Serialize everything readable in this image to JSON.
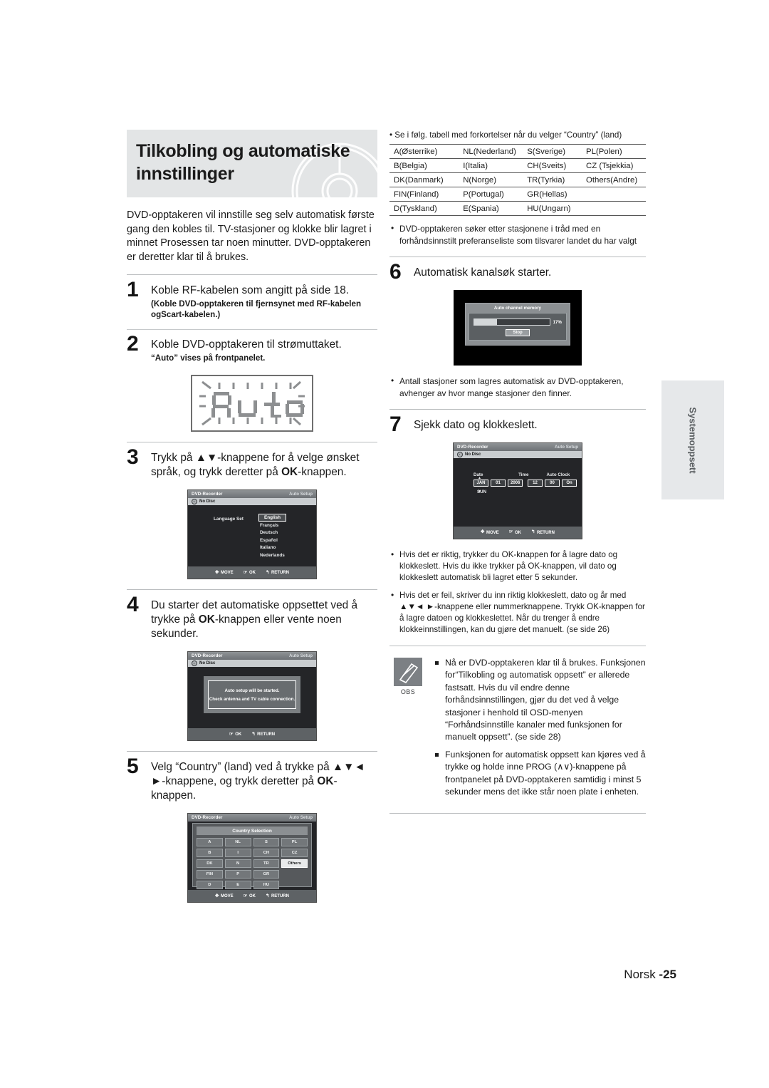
{
  "header": {
    "title": "Tilkobling og automatiske innstillinger",
    "disc_icon": "dvd-disc-illustration"
  },
  "intro": "DVD-opptakeren vil innstille seg selv automatisk første gang den kobles til. TV-stasjoner og klokke blir lagret i minnet Prosessen tar noen minutter. DVD-opptakeren er deretter klar til å brukes.",
  "steps": {
    "step1": {
      "number": "1",
      "title": "Koble RF-kabelen som angitt på side 18.",
      "sub": "(Koble DVD-opptakeren til fjernsynet med RF-kabelen ogScart-kabelen.)"
    },
    "step2": {
      "number": "2",
      "title": "Koble DVD-opptakeren til strømuttaket.",
      "sub": "“Auto” vises på frontpanelet.",
      "lcd_text": "Auto"
    },
    "step3": {
      "number": "3",
      "title_part1": "Trykk på ▲▼-knappene for å velge ønsket språk, og trykk deretter på ",
      "title_bold": "OK",
      "title_part2": "-knappen."
    },
    "step4": {
      "number": "4",
      "title_part1": "Du starter det automatiske oppsettet ved å trykke på ",
      "title_bold": "OK",
      "title_part2": "-knappen eller vente noen sekunder."
    },
    "step5": {
      "number": "5",
      "title_part1": "Velg “Country” (land) ved å trykke på ▲▼◄ ►-knappene, og trykk deretter på ",
      "title_bold": "OK",
      "title_part2": "-knappen."
    },
    "step6": {
      "number": "6",
      "title": "Automatisk kanalsøk starter."
    },
    "step7": {
      "number": "7",
      "title": "Sjekk dato og klokkeslett."
    }
  },
  "osd": {
    "common": {
      "brand": "DVD-Recorder",
      "mode": "Auto Setup",
      "disc_status": "No Disc",
      "footer_move": "MOVE",
      "footer_ok": "OK",
      "footer_return": "RETURN",
      "glyph_move": "✥",
      "glyph_ok": "☞",
      "glyph_return": "↰"
    },
    "language_screen": {
      "label": "Language Set",
      "options": [
        "English",
        "Français",
        "Deutsch",
        "Español",
        "Italiano",
        "Nederlands"
      ],
      "selected": "English"
    },
    "notice_screen": {
      "line1": "Auto setup will be started.",
      "line2": "Check antenna and TV cable connection."
    },
    "country_screen": {
      "heading": "Country Selection",
      "cells": [
        [
          "A",
          "NL",
          "S",
          "PL"
        ],
        [
          "B",
          "I",
          "CH",
          "CZ"
        ],
        [
          "DK",
          "N",
          "TR",
          "Others"
        ],
        [
          "FIN",
          "P",
          "GR",
          ""
        ],
        [
          "D",
          "E",
          "HU",
          ""
        ]
      ],
      "selected": "Others"
    },
    "channel_memory_screen": {
      "title": "Auto channel memory",
      "percent_label": "17%",
      "percent_value": 17,
      "bar_fill_ratio": 30,
      "stop_label": "Stop"
    },
    "clock_screen": {
      "head_date": "Date",
      "head_time": "Time",
      "head_autoclock": "Auto Clock",
      "month": "JAN",
      "day": "01",
      "year": "2006",
      "hour": "12",
      "minute": "00",
      "autoclock": "On",
      "weekday": "SUN"
    }
  },
  "abbr_table": {
    "caption": "• Se i følg. tabell med forkortelser når du velger “Country” (land)",
    "rows": [
      [
        "A(Østerrike)",
        "NL(Nederland)",
        "S(Sverige)",
        "PL(Polen)"
      ],
      [
        "B(Belgia)",
        "I(Italia)",
        "CH(Sveits)",
        "CZ (Tsjekkia)"
      ],
      [
        "DK(Danmark)",
        "N(Norge)",
        "TR(Tyrkia)",
        "Others(Andre)"
      ],
      [
        "FIN(Finland)",
        "P(Portugal)",
        "GR(Hellas)",
        ""
      ],
      [
        "D(Tyskland)",
        "E(Spania)",
        "HU(Ungarn)",
        ""
      ]
    ]
  },
  "bullets": {
    "after_table": "DVD-opptakeren søker etter stasjonene i tråd med en forhåndsinnstilt preferanseliste som tilsvarer landet du har valgt",
    "after_step6": "Antall stasjoner som lagres automatisk av DVD-opptakeren, avhenger av hvor mange stasjoner den finner.",
    "after_step7_a": "Hvis det er riktig, trykker du OK-knappen for å lagre dato og klokkeslett. Hvis du ikke trykker på OK-knappen, vil dato og klokkeslett automatisk bli lagret etter 5 sekunder.",
    "after_step7_b": "Hvis det er feil, skriver du inn riktig klokkeslett, dato og år med ▲▼◄ ►-knappene eller nummerknappene. Trykk OK-knappen for å lagre datoen og klokkeslettet. Når du trenger å endre klokkeinnstillingen, kan du gjøre det manuelt. (se side 26)"
  },
  "note": {
    "icon": "pencil-note-icon",
    "label": "OBS",
    "items": [
      "Nå er DVD-opptakeren klar til å brukes. Funksjonen for“Tilkobling og automatisk oppsett” er allerede fastsatt. Hvis du vil endre denne forhåndsinnstillingen, gjør du det ved å velge stasjoner i henhold til OSD-menyen “Forhåndsinnstille kanaler med funksjonen for manuelt oppsett”. (se side 28)",
      "Funksjonen for automatisk oppsett kan kjøres ved å trykke og holde inne PROG (∧∨)-knappene på frontpanelet på DVD-opptakeren samtidig i minst 5 sekunder mens det ikke står noen plate i enheten."
    ]
  },
  "side_tab": {
    "label": "Systemoppsett"
  },
  "footer": {
    "language": "Norsk ",
    "page": "-25"
  }
}
